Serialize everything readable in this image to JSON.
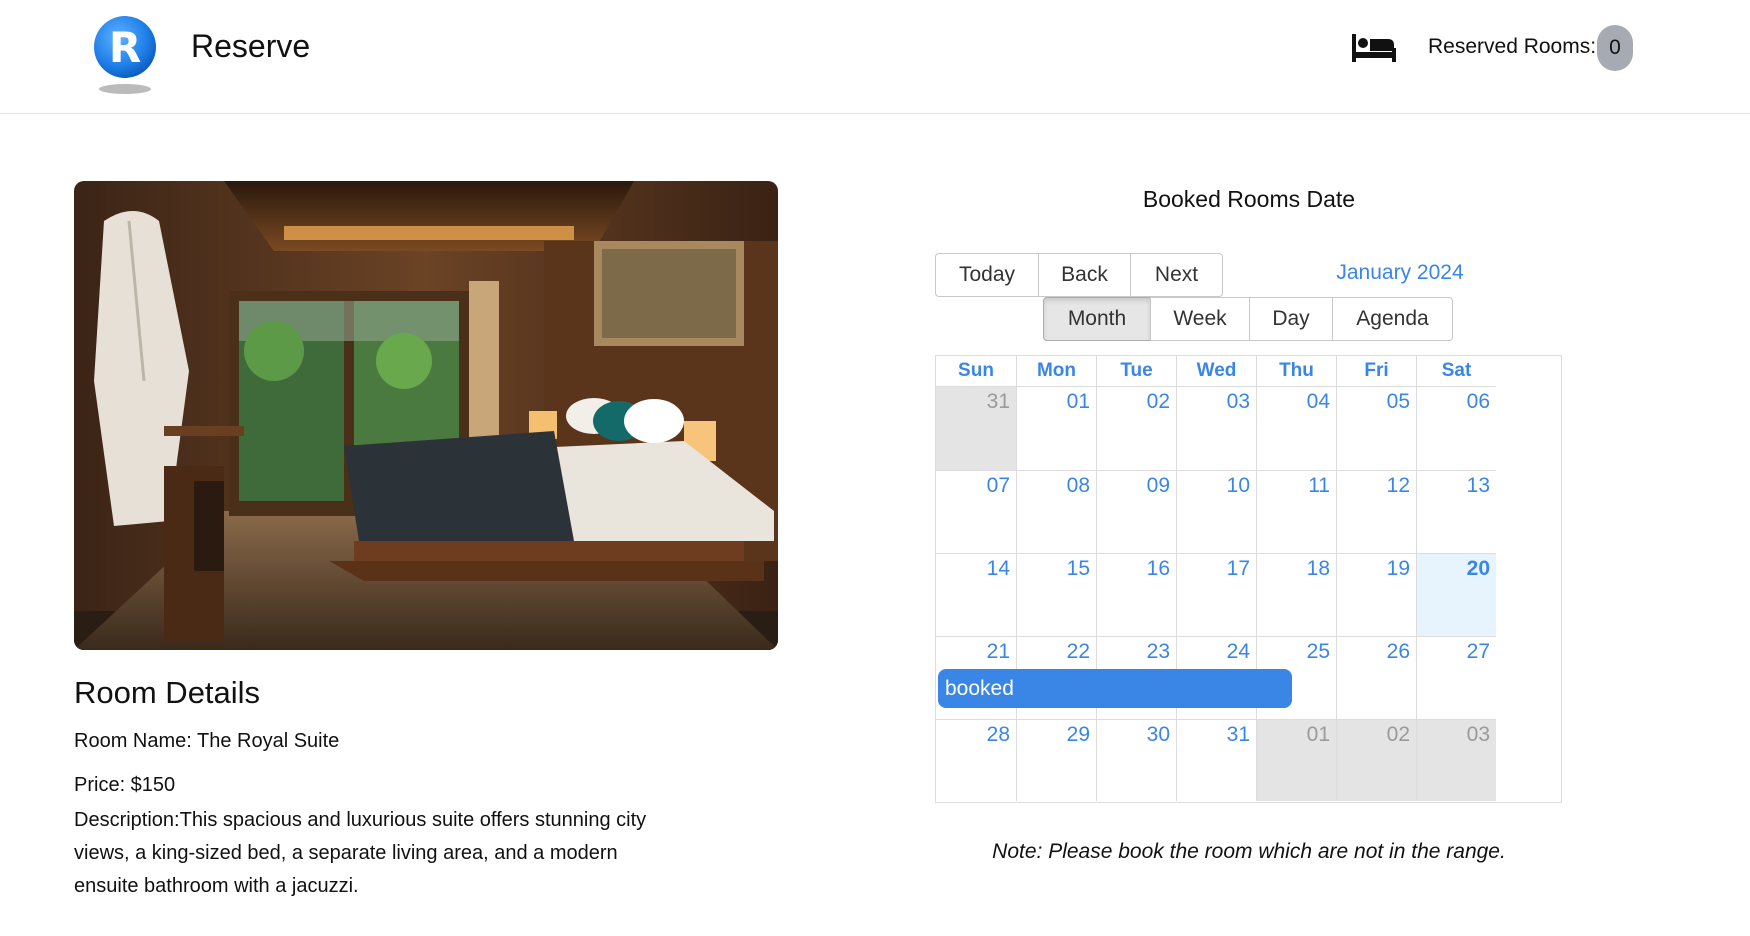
{
  "header": {
    "logo_letter": "R",
    "brand": "Reserve",
    "reserved_label": "Reserved Rooms:",
    "reserved_count": "0",
    "bed_icon": "bed-icon"
  },
  "room": {
    "details_title": "Room Details",
    "name_label": "Room Name: The Royal Suite",
    "price_label": "Price: $150",
    "description": "Description:This spacious and luxurious suite offers stunning city views, a king-sized bed, a separate living area, and a modern ensuite bathroom with a jacuzzi."
  },
  "calendar": {
    "title": "Booked Rooms Date",
    "nav_buttons": [
      "Today",
      "Back",
      "Next"
    ],
    "month_label": "January 2024",
    "view_buttons": [
      "Month",
      "Week",
      "Day",
      "Agenda"
    ],
    "active_view": "Month",
    "weekdays": [
      "Sun",
      "Mon",
      "Tue",
      "Wed",
      "Thu",
      "Fri",
      "Sat"
    ],
    "weeks": [
      [
        "31",
        "01",
        "02",
        "03",
        "04",
        "05",
        "06"
      ],
      [
        "07",
        "08",
        "09",
        "10",
        "11",
        "12",
        "13"
      ],
      [
        "14",
        "15",
        "16",
        "17",
        "18",
        "19",
        "20"
      ],
      [
        "21",
        "22",
        "23",
        "24",
        "25",
        "26",
        "27"
      ],
      [
        "28",
        "29",
        "30",
        "31",
        "01",
        "02",
        "03"
      ]
    ],
    "today": "20",
    "event_label": "booked",
    "event_range": [
      "21",
      "24"
    ],
    "accent_color": "#3a86e6",
    "note": "Note: Please book the room which are not in the range."
  }
}
